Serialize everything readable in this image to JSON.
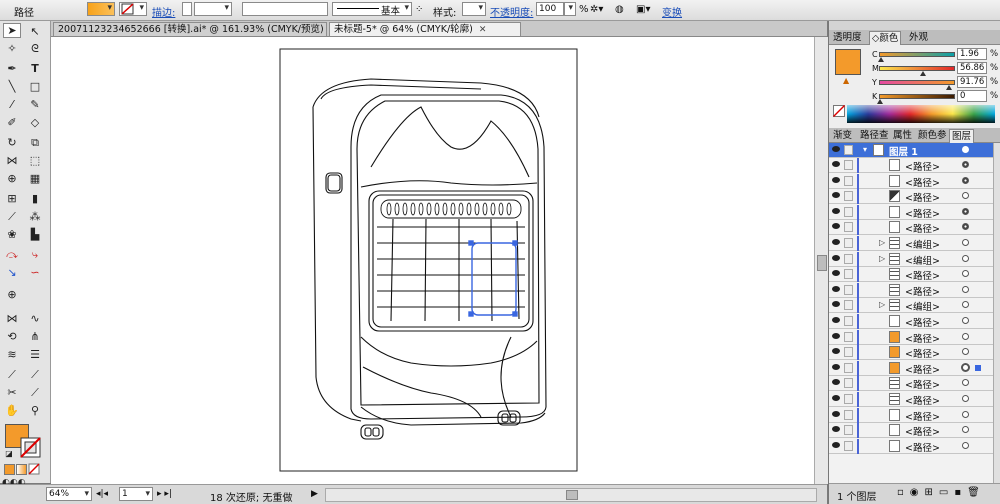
{
  "control_bar": {
    "object_type": "路径",
    "stroke_label": "描边:",
    "stroke_style": "基本",
    "style_label": "样式:",
    "opacity_label": "不透明度:",
    "opacity_value": "100",
    "opacity_unit": "%",
    "transform_label": "变换"
  },
  "tabs": [
    {
      "label": "20071123234652666 [转换].ai* @ 161.93% (CMYK/预览)",
      "close": "✕"
    },
    {
      "label": "未标题-5* @ 64% (CMYK/轮廓)",
      "close": "✕"
    }
  ],
  "status": {
    "zoom": "64%",
    "page": "1",
    "undo_info": "18 次还原; 无重做"
  },
  "color_panel": {
    "tabs": [
      "透明度",
      "颜色",
      "外观"
    ],
    "channels": [
      {
        "label": "C",
        "value": "1.96",
        "unit": "%"
      },
      {
        "label": "M",
        "value": "56.86",
        "unit": "%"
      },
      {
        "label": "Y",
        "value": "91.76",
        "unit": "%"
      },
      {
        "label": "K",
        "value": "0",
        "unit": "%"
      }
    ],
    "swatch": "#f39a2b"
  },
  "layers_panel": {
    "tabs": [
      "渐变",
      "路径查",
      "属性",
      "颜色参",
      "图层"
    ],
    "top_layer": "图层 1",
    "items": [
      {
        "name": "<路径>",
        "kind": "white",
        "tgt": "filled"
      },
      {
        "name": "<路径>",
        "kind": "white",
        "tgt": "filled"
      },
      {
        "name": "<路径>",
        "kind": "dark",
        "tgt": "open"
      },
      {
        "name": "<路径>",
        "kind": "white",
        "tgt": "filled"
      },
      {
        "name": "<路径>",
        "kind": "white",
        "tgt": "filled"
      },
      {
        "name": "<编组>",
        "kind": "lines",
        "tgt": "open",
        "group": true
      },
      {
        "name": "<编组>",
        "kind": "lines",
        "tgt": "open",
        "group": true
      },
      {
        "name": "<路径>",
        "kind": "lines",
        "tgt": "open"
      },
      {
        "name": "<路径>",
        "kind": "lines",
        "tgt": "open"
      },
      {
        "name": "<编组>",
        "kind": "lines",
        "tgt": "open",
        "group": true
      },
      {
        "name": "<路径>",
        "kind": "white",
        "tgt": "open"
      },
      {
        "name": "<路径>",
        "kind": "orange",
        "tgt": "open"
      },
      {
        "name": "<路径>",
        "kind": "orange",
        "tgt": "open"
      },
      {
        "name": "<路径>",
        "kind": "orange",
        "tgt": "selected"
      },
      {
        "name": "<路径>",
        "kind": "lines",
        "tgt": "open"
      },
      {
        "name": "<路径>",
        "kind": "lines",
        "tgt": "open"
      },
      {
        "name": "<路径>",
        "kind": "white",
        "tgt": "open"
      },
      {
        "name": "<路径>",
        "kind": "white",
        "tgt": "open"
      },
      {
        "name": "<路径>",
        "kind": "white",
        "tgt": "open"
      }
    ],
    "footer": "1 个图层"
  }
}
